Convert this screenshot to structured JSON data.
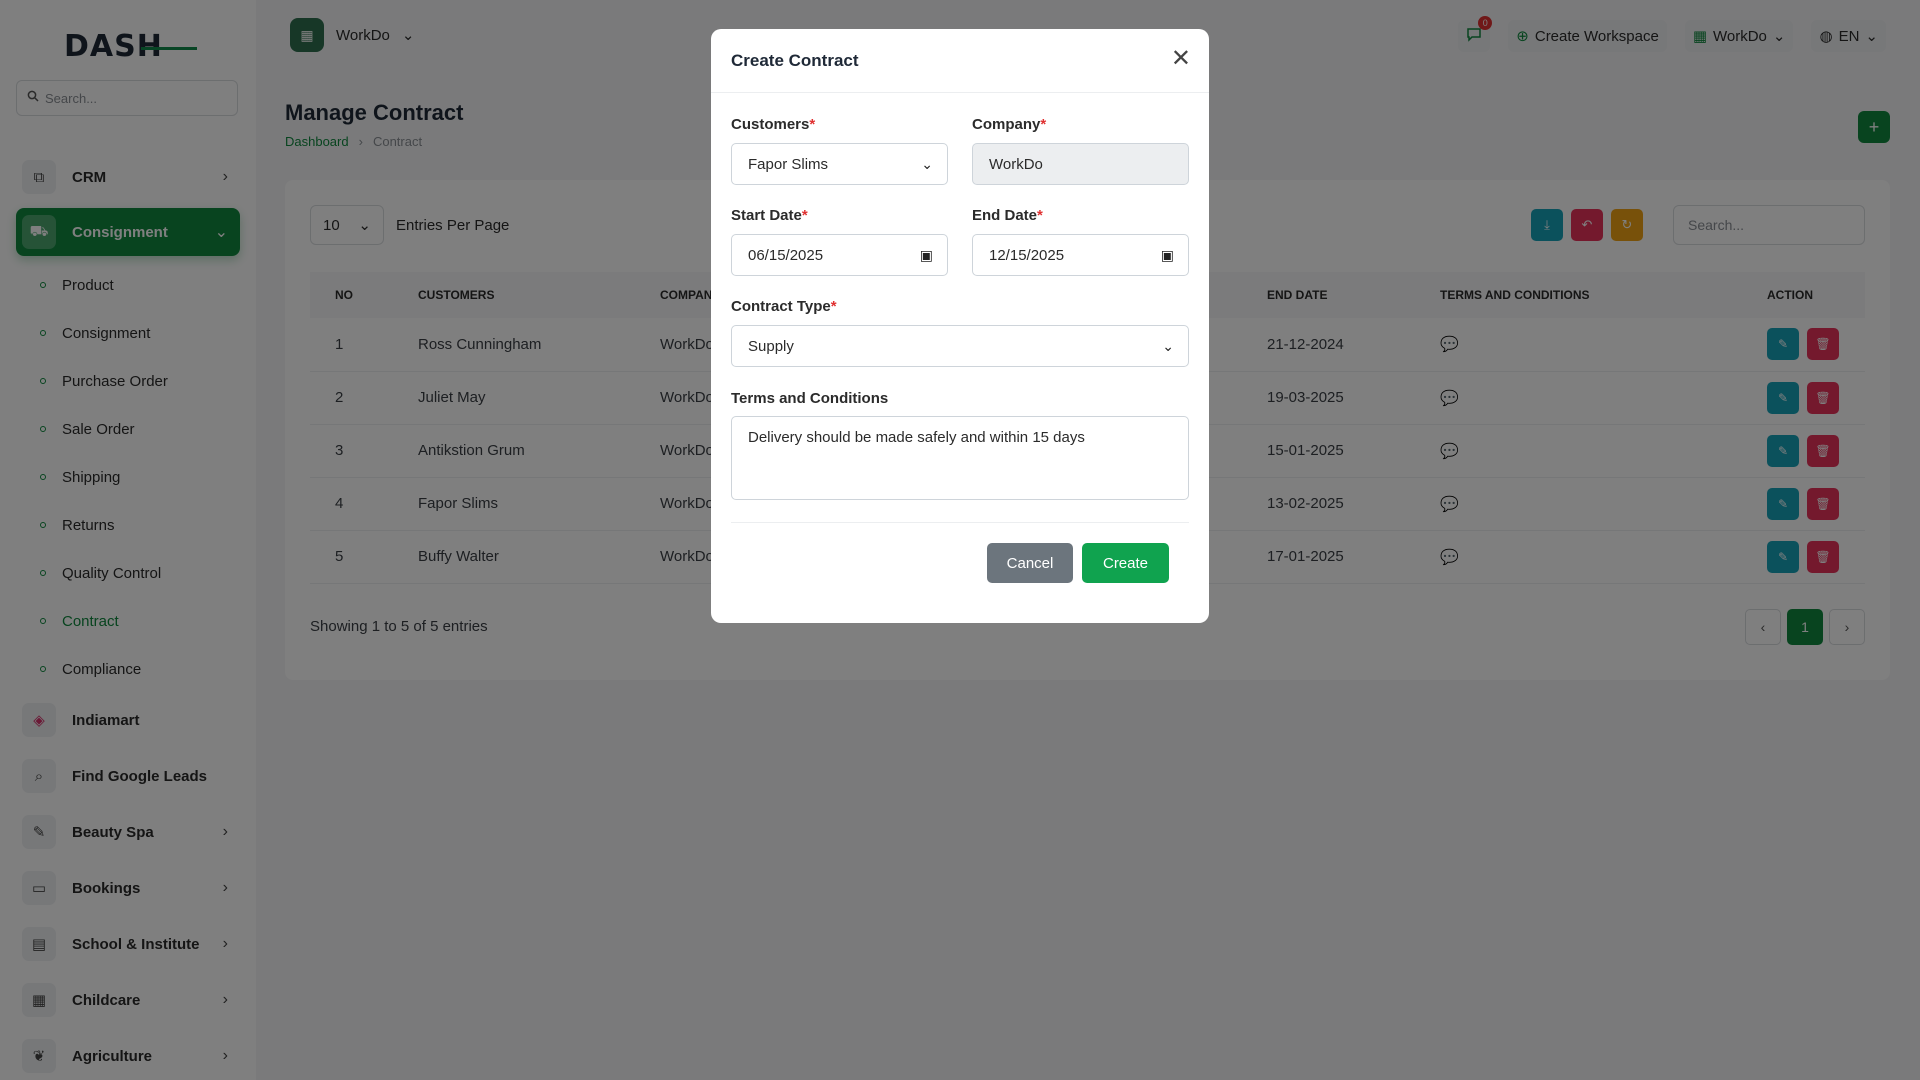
{
  "sidebar": {
    "logo": "DASH",
    "search_placeholder": "Search...",
    "items": [
      {
        "label": "CRM",
        "icon": "layers-icon"
      },
      {
        "label": "Consignment",
        "icon": "truck-icon"
      },
      {
        "label": "Indiamart",
        "icon": "indiamart-icon"
      },
      {
        "label": "Find Google Leads",
        "icon": "search-icon"
      },
      {
        "label": "Beauty Spa",
        "icon": "brush-icon"
      },
      {
        "label": "Bookings",
        "icon": "book-icon"
      },
      {
        "label": "School & Institute",
        "icon": "school-icon"
      },
      {
        "label": "Childcare",
        "icon": "building-icon"
      },
      {
        "label": "Agriculture",
        "icon": "plant-icon"
      }
    ],
    "sub_items": [
      "Product",
      "Consignment",
      "Purchase Order",
      "Sale Order",
      "Shipping",
      "Returns",
      "Quality Control",
      "Contract",
      "Compliance"
    ]
  },
  "topbar": {
    "workspace": "WorkDo",
    "notification_count": "0",
    "create_workspace": "Create Workspace",
    "workspace_menu": "WorkDo",
    "language": "EN"
  },
  "page": {
    "title": "Manage Contract",
    "breadcrumb_home": "Dashboard",
    "breadcrumb_current": "Contract"
  },
  "table": {
    "per_page": "10",
    "per_page_label": "Entries Per Page",
    "search_placeholder": "Search...",
    "columns": [
      "NO",
      "CUSTOMERS",
      "COMPANY",
      "END DATE",
      "TERMS AND CONDITIONS",
      "ACTION"
    ],
    "rows": [
      {
        "no": "1",
        "customer": "Ross Cunningham",
        "company": "WorkDo",
        "end": "21-12-2024"
      },
      {
        "no": "2",
        "customer": "Juliet May",
        "company": "WorkDo",
        "end": "19-03-2025"
      },
      {
        "no": "3",
        "customer": "Antikstion Grum",
        "company": "WorkDo",
        "end": "15-01-2025"
      },
      {
        "no": "4",
        "customer": "Fapor Slims",
        "company": "WorkDo",
        "end": "13-02-2025"
      },
      {
        "no": "5",
        "customer": "Buffy Walter",
        "company": "WorkDo",
        "end": "17-01-2025"
      }
    ],
    "showing": "Showing 1 to 5 of 5 entries",
    "current_page": "1"
  },
  "modal": {
    "title": "Create Contract",
    "customers_label": "Customers",
    "customers_value": "Fapor Slims",
    "company_label": "Company",
    "company_value": "WorkDo",
    "start_label": "Start Date",
    "start_value": "06/15/2025",
    "end_label": "End Date",
    "end_value": "12/15/2025",
    "type_label": "Contract Type",
    "type_value": "Supply",
    "terms_label": "Terms and Conditions",
    "terms_value": "Delivery should be made safely and within 15 days",
    "cancel": "Cancel",
    "create": "Create"
  },
  "colors": {
    "accent": "#10893f",
    "danger": "#e8335b",
    "info": "#17a2b8",
    "warning": "#f0a214"
  }
}
